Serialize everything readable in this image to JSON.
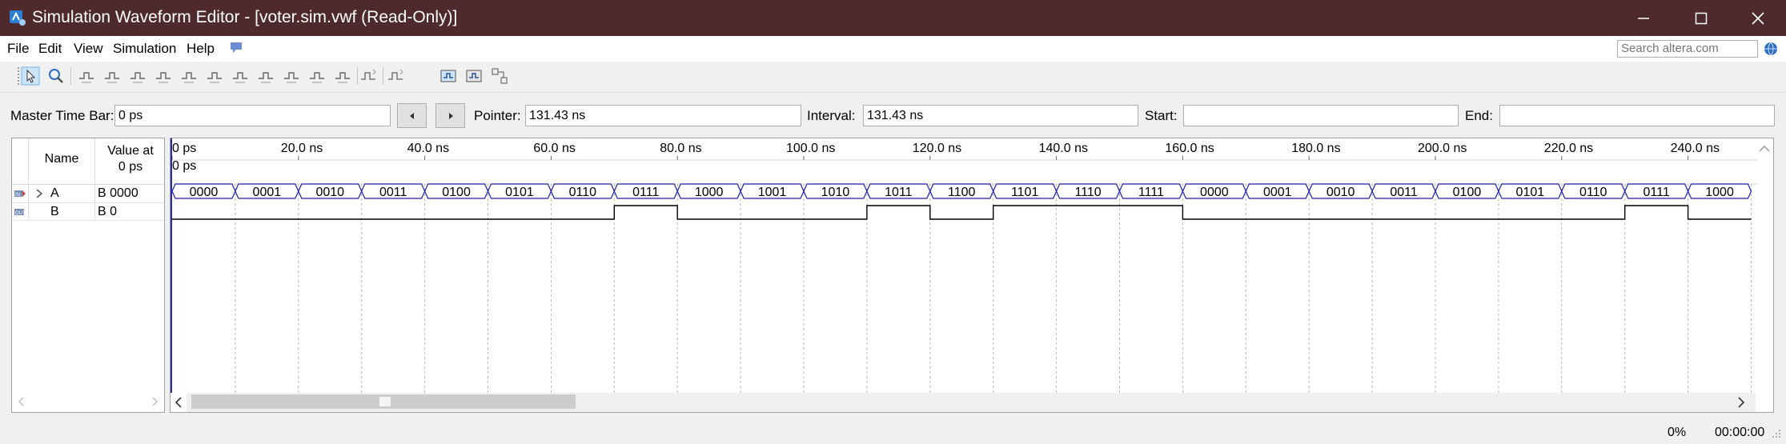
{
  "window": {
    "title": "Simulation Waveform Editor - [voter.sim.vwf (Read-Only)]"
  },
  "menu": {
    "items": [
      "File",
      "Edit",
      "View",
      "Simulation",
      "Help"
    ]
  },
  "search": {
    "placeholder": "Search altera.com"
  },
  "toolbar": {
    "icons": [
      "selection-tool-icon",
      "zoom-tool-icon",
      "force-unknown-icon",
      "force-low-icon",
      "force-high-icon",
      "force-high-impedance-icon",
      "force-weak-low-icon",
      "force-weak-high-icon",
      "invert-icon",
      "count-value-icon",
      "forcing-clock-icon",
      "arbitrary-value-icon",
      "random-values-icon",
      "snap-to-grid-icon",
      "snap-to-transitions-icon",
      "functional-simulation-icon",
      "timing-simulation-icon",
      "netlist-viewer-icon"
    ]
  },
  "fields": {
    "master_time_bar_label": "Master Time Bar:",
    "master_time_bar_value": "0 ps",
    "pointer_label": "Pointer:",
    "pointer_value": "131.43 ns",
    "interval_label": "Interval:",
    "interval_value": "131.43 ns",
    "start_label": "Start:",
    "start_value": "",
    "end_label": "End:",
    "end_value": ""
  },
  "signals_table": {
    "header_name": "Name",
    "header_value_line1": "Value at",
    "header_value_line2": "0 ps",
    "rows": [
      {
        "name": "A",
        "value": "B 0000",
        "type": "input",
        "expandable": true
      },
      {
        "name": "B",
        "value": "B 0",
        "type": "output",
        "expandable": false
      }
    ]
  },
  "waveform": {
    "time_start_marker": "0 ps",
    "ticks": [
      "0 ps",
      "20.0 ns",
      "40.0 ns",
      "60.0 ns",
      "80.0 ns",
      "100.0 ns",
      "120.0 ns",
      "140.0 ns",
      "160.0 ns",
      "180.0 ns",
      "200.0 ns",
      "220.0 ns",
      "240.0 ns"
    ],
    "time_per_segment_ns": 10,
    "bus_A_values": [
      "0000",
      "0001",
      "0010",
      "0011",
      "0100",
      "0101",
      "0110",
      "0111",
      "1000",
      "1001",
      "1010",
      "1011",
      "1100",
      "1101",
      "1110",
      "1111",
      "0000",
      "0001",
      "0010",
      "0011",
      "0100",
      "0101",
      "0110",
      "0111",
      "1000"
    ],
    "signal_B_levels": [
      0,
      0,
      0,
      0,
      0,
      0,
      0,
      1,
      0,
      0,
      0,
      1,
      0,
      1,
      1,
      1,
      0,
      0,
      0,
      0,
      0,
      0,
      0,
      1,
      0
    ]
  },
  "status": {
    "percent": "0%",
    "elapsed": "00:00:00"
  },
  "colors": {
    "titlebar": "#4f2a2c",
    "bus_outline": "#1f1fa8",
    "grid": "#b8b8b8"
  }
}
